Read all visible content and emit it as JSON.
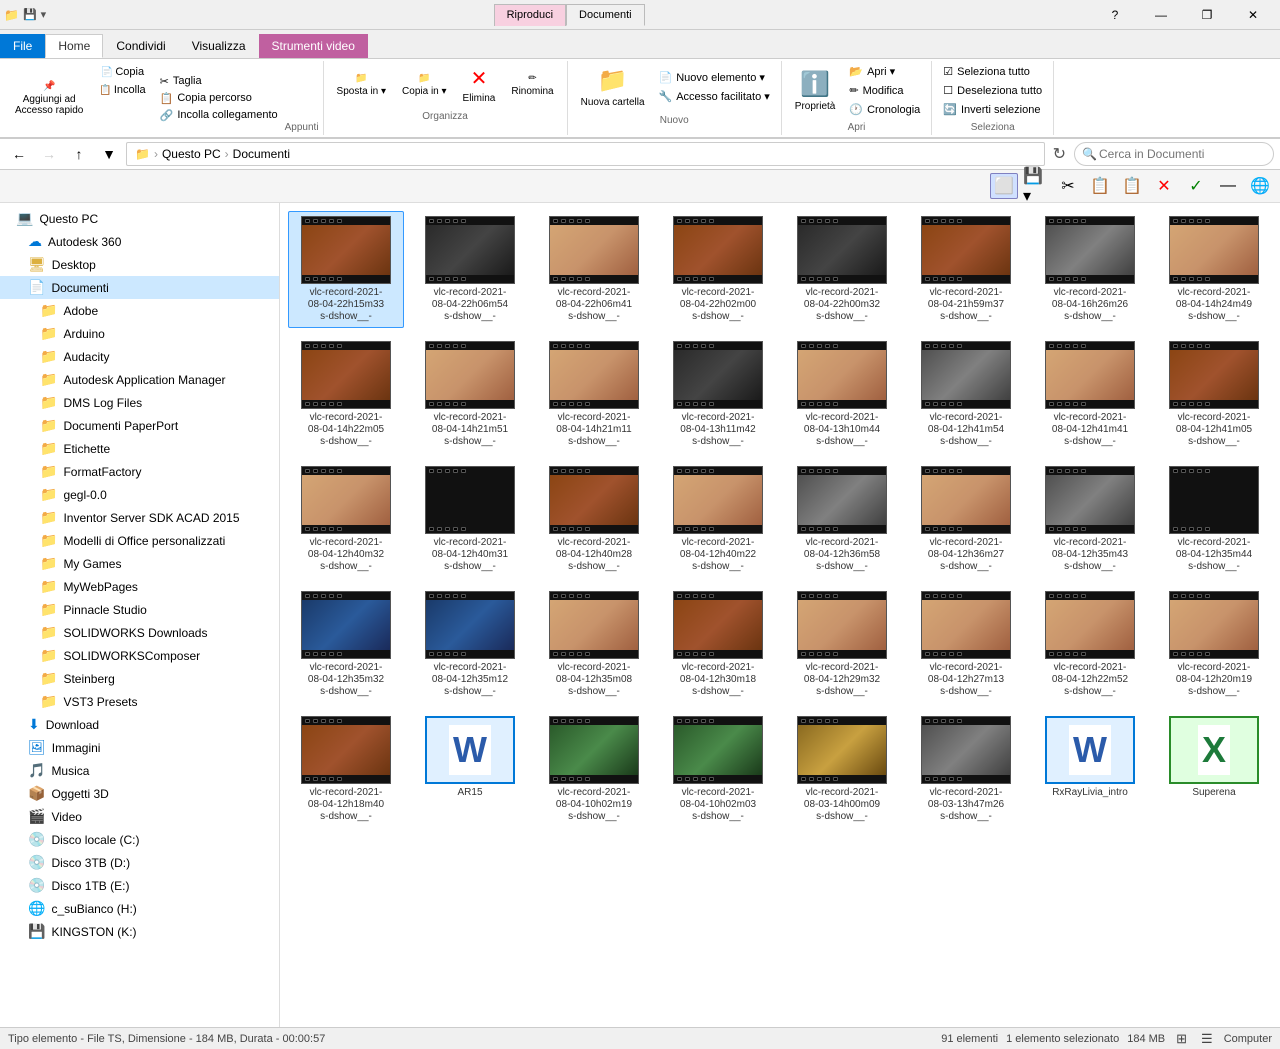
{
  "window": {
    "title": "Documenti",
    "controls": {
      "minimize": "—",
      "maximize": "❐",
      "close": "✕",
      "help": "?"
    }
  },
  "titlebar": {
    "tabs": [
      {
        "label": "Riproduci",
        "active": false,
        "pink": true
      },
      {
        "label": "Documenti",
        "active": true,
        "pink": false
      }
    ],
    "qat_icons": [
      "💾",
      "📋",
      "↩"
    ]
  },
  "ribbon": {
    "tabs": [
      {
        "label": "File",
        "active": false,
        "blue": true
      },
      {
        "label": "Home",
        "active": true
      },
      {
        "label": "Condividi",
        "active": false
      },
      {
        "label": "Visualizza",
        "active": false
      },
      {
        "label": "Strumenti video",
        "active": false,
        "video": true
      }
    ],
    "groups": {
      "appunti": {
        "label": "Appunti",
        "buttons": [
          {
            "label": "Aggiungi ad\nAccesso rapido",
            "icon": "📌"
          },
          {
            "label": "Copia",
            "icon": "📄"
          },
          {
            "label": "Incolla",
            "icon": "📋"
          }
        ],
        "small_buttons": [
          {
            "label": "Taglia",
            "icon": "✂"
          },
          {
            "label": "Copia percorso",
            "icon": "📋"
          },
          {
            "label": "Incolla collegamento",
            "icon": "🔗"
          }
        ]
      },
      "organizza": {
        "label": "Organizza",
        "buttons": [
          {
            "label": "Sposta in ▾",
            "icon": "📁"
          },
          {
            "label": "Copia in ▾",
            "icon": "📁"
          },
          {
            "label": "Elimina",
            "icon": "🗑",
            "red": true
          },
          {
            "label": "Rinomina",
            "icon": "✏"
          }
        ]
      },
      "nuovo": {
        "label": "Nuovo",
        "buttons": [
          {
            "label": "Nuova cartella",
            "icon": "📁"
          }
        ],
        "small_buttons": [
          {
            "label": "Nuovo elemento ▾",
            "icon": "📄"
          },
          {
            "label": "Accesso facilitato ▾",
            "icon": "🔧"
          }
        ]
      },
      "apri": {
        "label": "Apri",
        "buttons": [
          {
            "label": "Proprietà",
            "icon": "ℹ️"
          }
        ],
        "small_buttons": [
          {
            "label": "Apri ▾"
          },
          {
            "label": "Modifica"
          },
          {
            "label": "Cronologia"
          }
        ]
      },
      "seleziona": {
        "label": "Seleziona",
        "small_buttons": [
          {
            "label": "Seleziona tutto"
          },
          {
            "label": "Deseleziona tutto"
          },
          {
            "label": "Inverti selezione"
          }
        ]
      }
    }
  },
  "addressbar": {
    "back_enabled": true,
    "forward_enabled": false,
    "up_enabled": true,
    "path_parts": [
      "Questo PC",
      "Documenti"
    ],
    "search_placeholder": "Cerca in Documenti"
  },
  "toolbar": {
    "buttons": [
      "⬜",
      "💾▾",
      "✂",
      "📋",
      "📋",
      "✕",
      "✓",
      "—",
      "🌐"
    ]
  },
  "sidebar": {
    "items": [
      {
        "label": "Questo PC",
        "icon": "💻",
        "indent": 0,
        "type": "special"
      },
      {
        "label": "Autodesk 360",
        "icon": "☁",
        "indent": 1,
        "type": "special"
      },
      {
        "label": "Desktop",
        "icon": "🖥",
        "indent": 1,
        "type": "folder"
      },
      {
        "label": "Documenti",
        "icon": "📄",
        "indent": 1,
        "type": "folder",
        "selected": true
      },
      {
        "label": "Adobe",
        "icon": "📁",
        "indent": 2,
        "type": "folder"
      },
      {
        "label": "Arduino",
        "icon": "📁",
        "indent": 2,
        "type": "folder"
      },
      {
        "label": "Audacity",
        "icon": "📁",
        "indent": 2,
        "type": "folder"
      },
      {
        "label": "Autodesk Application Manager",
        "icon": "📁",
        "indent": 2,
        "type": "folder"
      },
      {
        "label": "DMS Log Files",
        "icon": "📁",
        "indent": 2,
        "type": "folder"
      },
      {
        "label": "Documenti PaperPort",
        "icon": "📁",
        "indent": 2,
        "type": "folder"
      },
      {
        "label": "Etichette",
        "icon": "📁",
        "indent": 2,
        "type": "folder"
      },
      {
        "label": "FormatFactory",
        "icon": "📁",
        "indent": 2,
        "type": "folder"
      },
      {
        "label": "gegl-0.0",
        "icon": "📁",
        "indent": 2,
        "type": "folder"
      },
      {
        "label": "Inventor Server SDK ACAD 2015",
        "icon": "📁",
        "indent": 2,
        "type": "folder"
      },
      {
        "label": "Modelli di Office personalizzati",
        "icon": "📁",
        "indent": 2,
        "type": "folder"
      },
      {
        "label": "My Games",
        "icon": "📁",
        "indent": 2,
        "type": "folder"
      },
      {
        "label": "MyWebPages",
        "icon": "📁",
        "indent": 2,
        "type": "folder"
      },
      {
        "label": "Pinnacle Studio",
        "icon": "📁",
        "indent": 2,
        "type": "folder"
      },
      {
        "label": "SOLIDWORKS Downloads",
        "icon": "📁",
        "indent": 2,
        "type": "folder"
      },
      {
        "label": "SOLIDWORKSComposer",
        "icon": "📁",
        "indent": 2,
        "type": "folder"
      },
      {
        "label": "Steinberg",
        "icon": "📁",
        "indent": 2,
        "type": "folder"
      },
      {
        "label": "VST3 Presets",
        "icon": "📁",
        "indent": 2,
        "type": "folder"
      },
      {
        "label": "Download",
        "icon": "⬇",
        "indent": 1,
        "type": "special"
      },
      {
        "label": "Immagini",
        "icon": "🖼",
        "indent": 1,
        "type": "special"
      },
      {
        "label": "Musica",
        "icon": "🎵",
        "indent": 1,
        "type": "special"
      },
      {
        "label": "Oggetti 3D",
        "icon": "📦",
        "indent": 1,
        "type": "special"
      },
      {
        "label": "Video",
        "icon": "🎬",
        "indent": 1,
        "type": "special"
      },
      {
        "label": "Disco locale (C:)",
        "icon": "💿",
        "indent": 1,
        "type": "drive"
      },
      {
        "label": "Disco 3TB (D:)",
        "icon": "💿",
        "indent": 1,
        "type": "drive"
      },
      {
        "label": "Disco 1TB (E:)",
        "icon": "💿",
        "indent": 1,
        "type": "drive"
      },
      {
        "label": "c_suBianco (H:)",
        "icon": "🌐",
        "indent": 1,
        "type": "drive"
      },
      {
        "label": "KINGSTON (K:)",
        "icon": "💾",
        "indent": 1,
        "type": "drive"
      }
    ]
  },
  "files": [
    {
      "name": "vlc-record-2021-\n08-04-22h15m33\ns-dshow__-",
      "type": "video",
      "thumb": "brown",
      "selected": true
    },
    {
      "name": "vlc-record-2021-\n08-04-22h06m54\ns-dshow__-",
      "type": "video",
      "thumb": "dark"
    },
    {
      "name": "vlc-record-2021-\n08-04-22h06m41\ns-dshow__-",
      "type": "video",
      "thumb": "hand"
    },
    {
      "name": "vlc-record-2021-\n08-04-22h02m00\ns-dshow__-",
      "type": "video",
      "thumb": "brown"
    },
    {
      "name": "vlc-record-2021-\n08-04-22h00m32\ns-dshow__-",
      "type": "video",
      "thumb": "dark"
    },
    {
      "name": "vlc-record-2021-\n08-04-21h59m37\ns-dshow__-",
      "type": "video",
      "thumb": "brown"
    },
    {
      "name": "vlc-record-2021-\n08-04-16h26m26\ns-dshow__-",
      "type": "video",
      "thumb": "gray"
    },
    {
      "name": "vlc-record-2021-\n08-04-14h24m49\ns-dshow__-",
      "type": "video",
      "thumb": "hand"
    },
    {
      "name": "vlc-record-2021-\n08-04-14h22m05\ns-dshow__-",
      "type": "video",
      "thumb": "brown"
    },
    {
      "name": "vlc-record-2021-\n08-04-14h21m51\ns-dshow__-",
      "type": "video",
      "thumb": "hand"
    },
    {
      "name": "vlc-record-2021-\n08-04-14h21m11\ns-dshow__-",
      "type": "video",
      "thumb": "hand"
    },
    {
      "name": "vlc-record-2021-\n08-04-13h11m42\ns-dshow__-",
      "type": "video",
      "thumb": "dark"
    },
    {
      "name": "vlc-record-2021-\n08-04-13h10m44\ns-dshow__-",
      "type": "video",
      "thumb": "hand"
    },
    {
      "name": "vlc-record-2021-\n08-04-12h41m54\ns-dshow__-",
      "type": "video",
      "thumb": "gray"
    },
    {
      "name": "vlc-record-2021-\n08-04-12h41m41\ns-dshow__-",
      "type": "video",
      "thumb": "hand"
    },
    {
      "name": "vlc-record-2021-\n08-04-12h41m05\ns-dshow__-",
      "type": "video",
      "thumb": "brown"
    },
    {
      "name": "vlc-record-2021-\n08-04-12h40m32\ns-dshow__-",
      "type": "video",
      "thumb": "hand"
    },
    {
      "name": "vlc-record-2021-\n08-04-12h40m31\ns-dshow__-",
      "type": "video",
      "thumb": "black"
    },
    {
      "name": "vlc-record-2021-\n08-04-12h40m28\ns-dshow__-",
      "type": "video",
      "thumb": "brown"
    },
    {
      "name": "vlc-record-2021-\n08-04-12h40m22\ns-dshow__-",
      "type": "video",
      "thumb": "hand"
    },
    {
      "name": "vlc-record-2021-\n08-04-12h36m58\ns-dshow__-",
      "type": "video",
      "thumb": "gray"
    },
    {
      "name": "vlc-record-2021-\n08-04-12h36m27\ns-dshow__-",
      "type": "video",
      "thumb": "hand"
    },
    {
      "name": "vlc-record-2021-\n08-04-12h35m43\ns-dshow__-",
      "type": "video",
      "thumb": "gray"
    },
    {
      "name": "vlc-record-2021-\n08-04-12h35m44\ns-dshow__-",
      "type": "video",
      "thumb": "black"
    },
    {
      "name": "vlc-record-2021-\n08-04-12h35m32\ns-dshow__-",
      "type": "video",
      "thumb": "blue"
    },
    {
      "name": "vlc-record-2021-\n08-04-12h35m12\ns-dshow__-",
      "type": "video",
      "thumb": "blue"
    },
    {
      "name": "vlc-record-2021-\n08-04-12h35m08\ns-dshow__-",
      "type": "video",
      "thumb": "hand"
    },
    {
      "name": "vlc-record-2021-\n08-04-12h30m18\ns-dshow__-",
      "type": "video",
      "thumb": "brown"
    },
    {
      "name": "vlc-record-2021-\n08-04-12h29m32\ns-dshow__-",
      "type": "video",
      "thumb": "hand"
    },
    {
      "name": "vlc-record-2021-\n08-04-12h27m13\ns-dshow__-",
      "type": "video",
      "thumb": "hand"
    },
    {
      "name": "vlc-record-2021-\n08-04-12h22m52\ns-dshow__-",
      "type": "video",
      "thumb": "hand"
    },
    {
      "name": "vlc-record-2021-\n08-04-12h20m19\ns-dshow__-",
      "type": "video",
      "thumb": "hand"
    },
    {
      "name": "vlc-record-2021-\n08-04-12h18m40\ns-dshow__-",
      "type": "video",
      "thumb": "brown"
    },
    {
      "name": "AR15",
      "type": "word",
      "thumb": "word"
    },
    {
      "name": "vlc-record-2021-\n08-04-10h02m19\ns-dshow__-",
      "type": "video",
      "thumb": "green"
    },
    {
      "name": "vlc-record-2021-\n08-04-10h02m03\ns-dshow__-",
      "type": "video",
      "thumb": "green"
    },
    {
      "name": "vlc-record-2021-\n08-03-14h00m09\ns-dshow__-",
      "type": "video",
      "thumb": "yellow"
    },
    {
      "name": "vlc-record-2021-\n08-03-13h47m26\ns-dshow__-",
      "type": "video",
      "thumb": "gray"
    },
    {
      "name": "RxRayLivia_intro",
      "type": "word",
      "thumb": "word"
    },
    {
      "name": "Superena",
      "type": "excel",
      "thumb": "excel"
    }
  ],
  "status": {
    "items_count": "91 elementi",
    "selected": "1 elemento selezionato",
    "size": "184 MB",
    "info_left": "Tipo elemento - File TS, Dimensione - 184 MB, Durata - 00:00:57",
    "info_right": "184 MB",
    "computer": "Computer"
  }
}
